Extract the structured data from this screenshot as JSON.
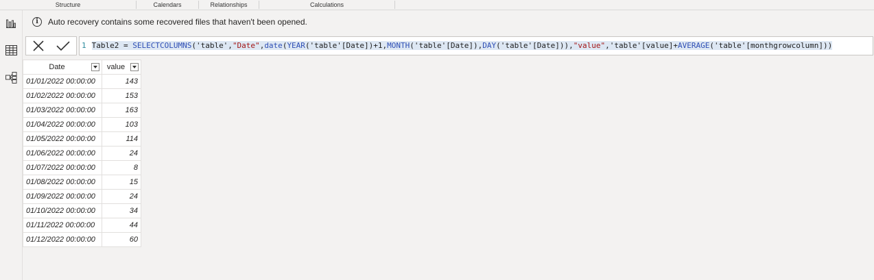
{
  "ribbon": {
    "groups": [
      "Structure",
      "Calendars",
      "Relationships",
      "Calculations"
    ]
  },
  "rail": {
    "icons": [
      "report-view-icon",
      "table-view-icon",
      "model-view-icon"
    ]
  },
  "infobar": {
    "message": "Auto recovery contains some recovered files that haven't been opened."
  },
  "formula": {
    "line_number": "1",
    "tokens": [
      {
        "t": "Table2 = ",
        "k": "tbl"
      },
      {
        "t": "SELECTCOLUMNS",
        "k": "fn"
      },
      {
        "t": "('table',",
        "k": "tbl"
      },
      {
        "t": "\"Date\"",
        "k": "str"
      },
      {
        "t": ",",
        "k": "tbl"
      },
      {
        "t": "date",
        "k": "fn"
      },
      {
        "t": "(",
        "k": "tbl"
      },
      {
        "t": "YEAR",
        "k": "fn"
      },
      {
        "t": "('table'[Date])+1,",
        "k": "tbl"
      },
      {
        "t": "MONTH",
        "k": "fn"
      },
      {
        "t": "('table'[Date]),",
        "k": "tbl"
      },
      {
        "t": "DAY",
        "k": "fn"
      },
      {
        "t": "('table'[Date])),",
        "k": "tbl"
      },
      {
        "t": "\"value\"",
        "k": "str"
      },
      {
        "t": ",'table'[value]+",
        "k": "tbl"
      },
      {
        "t": "AVERAGE",
        "k": "fn"
      },
      {
        "t": "('table'[monthgrowcolumn]))",
        "k": "tbl"
      }
    ]
  },
  "table": {
    "columns": [
      "Date",
      "value"
    ],
    "rows": [
      [
        "01/01/2022 00:00:00",
        "143"
      ],
      [
        "01/02/2022 00:00:00",
        "153"
      ],
      [
        "01/03/2022 00:00:00",
        "163"
      ],
      [
        "01/04/2022 00:00:00",
        "103"
      ],
      [
        "01/05/2022 00:00:00",
        "114"
      ],
      [
        "01/06/2022 00:00:00",
        "24"
      ],
      [
        "01/07/2022 00:00:00",
        "8"
      ],
      [
        "01/08/2022 00:00:00",
        "15"
      ],
      [
        "01/09/2022 00:00:00",
        "24"
      ],
      [
        "01/10/2022 00:00:00",
        "34"
      ],
      [
        "01/11/2022 00:00:00",
        "44"
      ],
      [
        "01/12/2022 00:00:00",
        "60"
      ]
    ]
  }
}
